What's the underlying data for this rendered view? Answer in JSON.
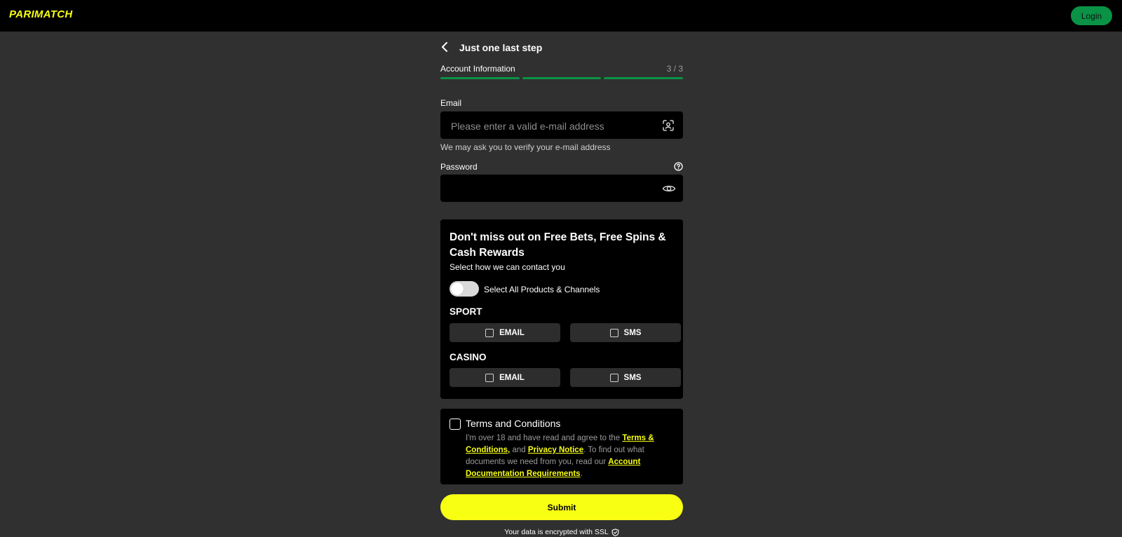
{
  "header": {
    "logo_text": "PARIMATCH",
    "login_label": "Login"
  },
  "step": {
    "title": "Just one last step",
    "section_label": "Account Information",
    "count": "3 / 3",
    "total_steps": 3,
    "completed_steps": 3
  },
  "email": {
    "label": "Email",
    "placeholder": "Please enter a valid e-mail address",
    "value": "",
    "hint": "We may ask you to verify your e-mail address"
  },
  "password": {
    "label": "Password",
    "value": ""
  },
  "promo": {
    "title": "Don't miss out on Free Bets, Free Spins & Cash Rewards",
    "subtitle": "Select how we can contact you",
    "toggle_label": "Select All Products & Channels",
    "toggle_on": false,
    "sport": {
      "heading": "SPORT",
      "email_label": "EMAIL",
      "sms_label": "SMS"
    },
    "casino": {
      "heading": "CASINO",
      "email_label": "EMAIL",
      "sms_label": "SMS"
    }
  },
  "terms": {
    "title": "Terms and Conditions",
    "text_1": "I'm over 18 and have read and agree to the ",
    "link_terms": "Terms & Conditions,",
    "text_2": " and ",
    "link_privacy": "Privacy Notice",
    "text_3": ". To find out what documents we need from you, read our ",
    "link_docs": "Account Documentation Requirements",
    "text_4": "."
  },
  "submit_label": "Submit",
  "ssl_text": "Your data is encrypted with SSL",
  "colors": {
    "brand_yellow": "#f8ff13",
    "accent_green": "#0a9346",
    "background": "#303030",
    "panel": "#000000"
  },
  "icons": {
    "back": "chevron-left-icon",
    "email_field": "face-scan-icon",
    "password_help": "question-circle-icon",
    "password_visibility": "eye-icon",
    "ssl": "shield-check-icon"
  }
}
